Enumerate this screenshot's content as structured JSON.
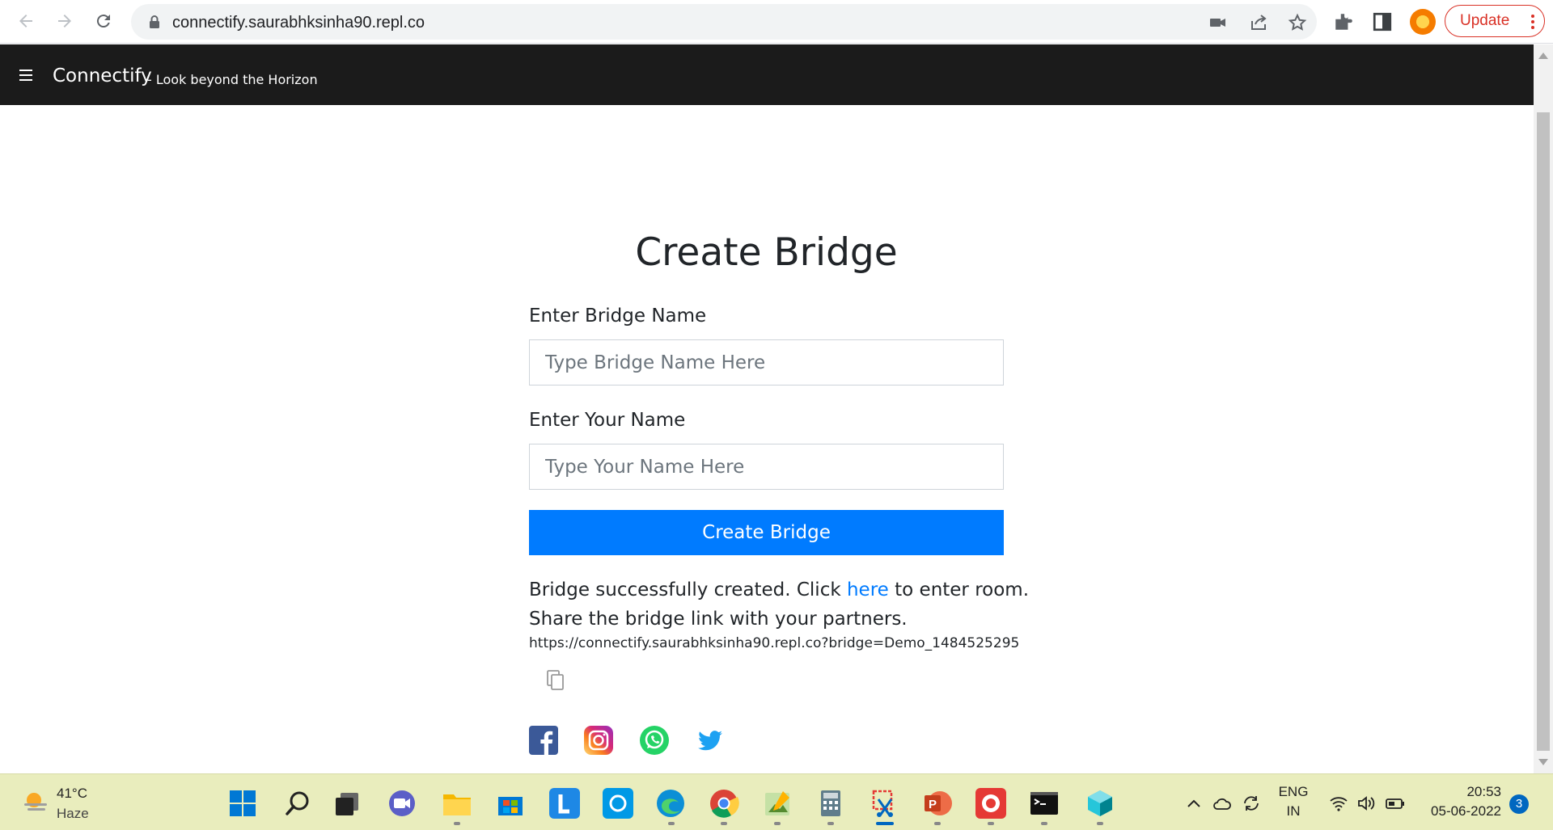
{
  "browser": {
    "url": "connectify.saurabhksinha90.repl.co",
    "update_label": "Update"
  },
  "app": {
    "brand": "Connectify",
    "tagline": "- Look beyond the Horizon"
  },
  "form": {
    "title": "Create Bridge",
    "bridge_name_label": "Enter Bridge Name",
    "bridge_name_placeholder": "Type Bridge Name Here",
    "your_name_label": "Enter Your Name",
    "your_name_placeholder": "Type Your Name Here",
    "submit_label": "Create Bridge"
  },
  "result": {
    "success_prefix": "Bridge successfully created. Click ",
    "link_text": "here",
    "success_suffix": " to enter room.",
    "share_text": "Share the bridge link with your partners.",
    "bridge_link": "https://connectify.saurabhksinha90.repl.co?bridge=Demo_1484525295"
  },
  "social": [
    "facebook-icon",
    "instagram-icon",
    "whatsapp-icon",
    "twitter-icon"
  ],
  "colors": {
    "primary": "#007bff",
    "navbar": "#1b1b1b",
    "taskbar": "#e9edbd"
  },
  "taskbar": {
    "temperature": "41°C",
    "condition": "Haze",
    "lang_top": "ENG",
    "lang_bottom": "IN",
    "time": "20:53",
    "date": "05-06-2022",
    "notification_count": "3"
  }
}
